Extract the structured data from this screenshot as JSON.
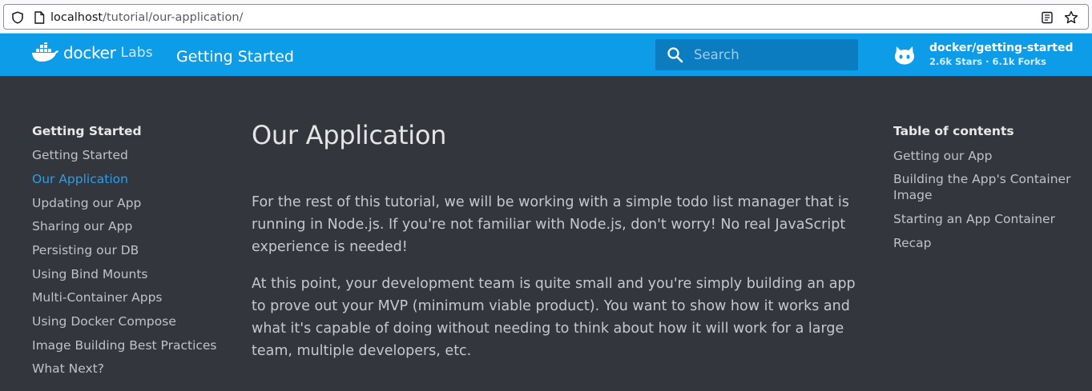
{
  "browser": {
    "url_host": "localhost",
    "url_path": "/tutorial/our-application/"
  },
  "header": {
    "logo_docker": "docker",
    "logo_labs": "Labs",
    "site_title": "Getting Started",
    "search_placeholder": "Search",
    "repo_name": "docker/getting-started",
    "repo_stats": "2.6k Stars · 6.1k Forks"
  },
  "nav": {
    "title": "Getting Started",
    "items": [
      {
        "label": "Getting Started"
      },
      {
        "label": "Our Application",
        "active": true
      },
      {
        "label": "Updating our App"
      },
      {
        "label": "Sharing our App"
      },
      {
        "label": "Persisting our DB"
      },
      {
        "label": "Using Bind Mounts"
      },
      {
        "label": "Multi-Container Apps"
      },
      {
        "label": "Using Docker Compose"
      },
      {
        "label": "Image Building Best Practices"
      },
      {
        "label": "What Next?"
      }
    ]
  },
  "main": {
    "title": "Our Application",
    "paragraphs": [
      "For the rest of this tutorial, we will be working with a simple todo list manager that is running in Node.js. If you're not familiar with Node.js, don't worry! No real JavaScript experience is needed!",
      "At this point, your development team is quite small and you're simply building an app to prove out your MVP (minimum viable product). You want to show how it works and what it's capable of doing without needing to think about how it will work for a large team, multiple developers, etc."
    ]
  },
  "toc": {
    "title": "Table of contents",
    "items": [
      {
        "label": "Getting our App"
      },
      {
        "label": "Building the App's Container Image"
      },
      {
        "label": "Starting an App Container"
      },
      {
        "label": "Recap"
      }
    ]
  },
  "colors": {
    "header_bg": "#0c9ce8",
    "page_bg": "#33363d",
    "active_link": "#2a9fe8"
  },
  "icons": [
    "shield-icon",
    "page-icon",
    "reader-view-icon",
    "bookmark-star-icon",
    "docker-whale-icon",
    "search-icon",
    "github-icon"
  ]
}
